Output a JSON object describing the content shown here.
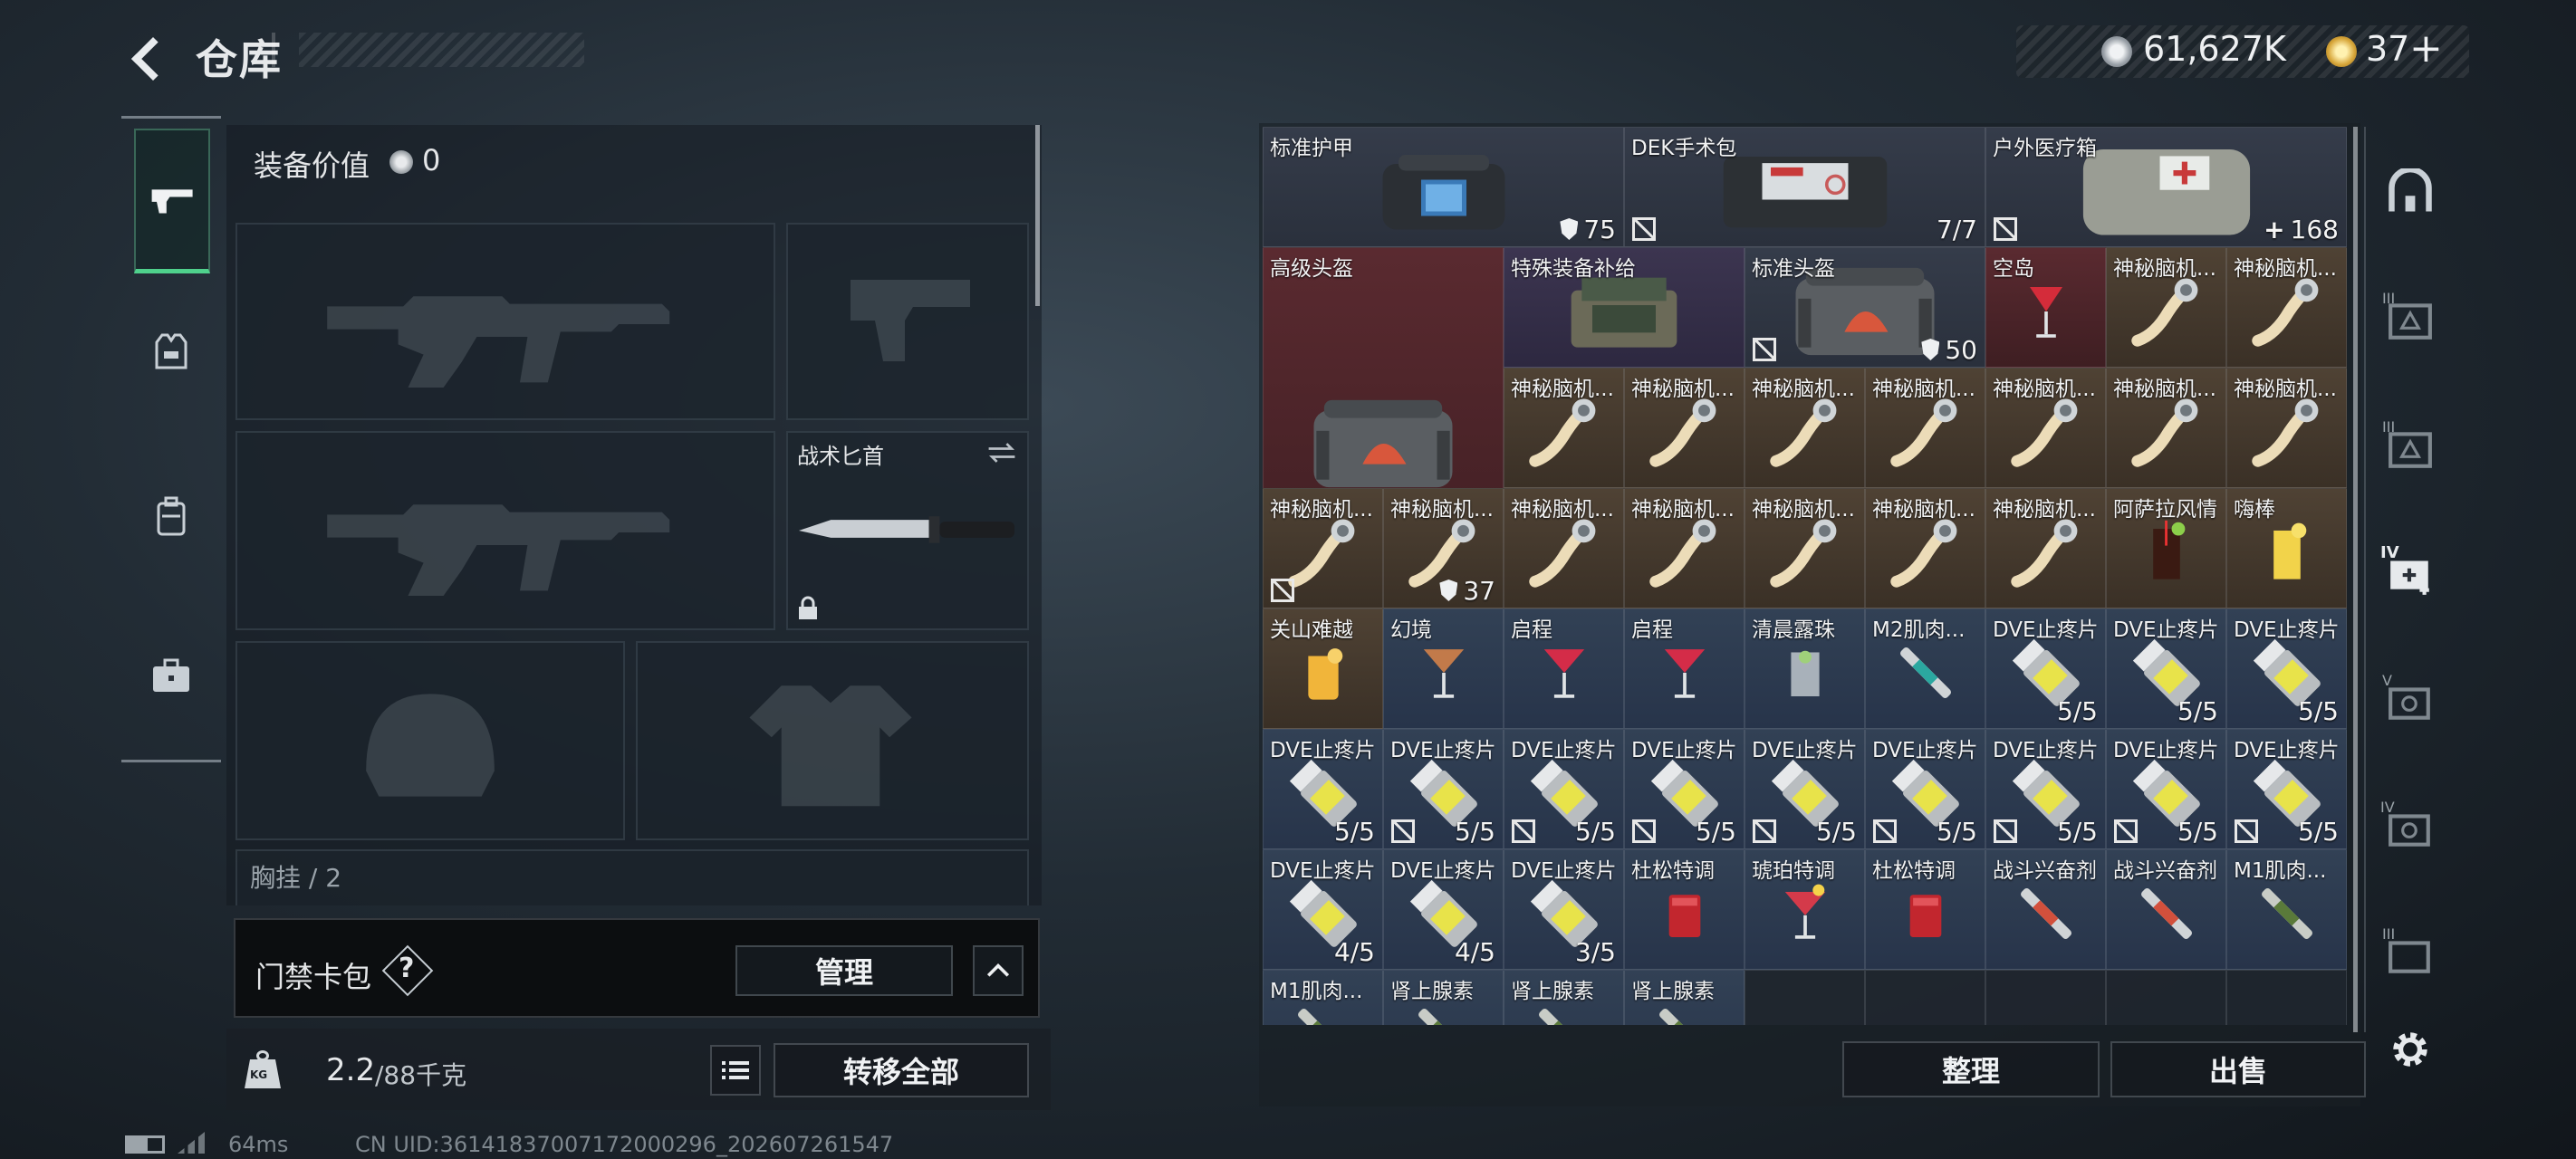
{
  "header": {
    "title": "仓库",
    "coins": "61,627K",
    "tickets": "37",
    "tickets_plus": "+"
  },
  "left": {
    "equip_value_label": "装备价值",
    "equip_value": "0",
    "knife_label": "战术匕首",
    "chest_label": "胸挂 / 2",
    "keycard_label": "门禁卡包",
    "keycard_help": "?",
    "manage_label": "管理",
    "weight_value": "2.2",
    "weight_unit": "/88千克",
    "kg_icon_text": "KG",
    "transfer_all_label": "转移全部"
  },
  "footer": {
    "ping": "64ms",
    "uid": "CN UID:36141837007172000296_202607261547"
  },
  "actions": {
    "sort_label": "整理",
    "sell_label": "出售"
  },
  "side_labels": {
    "t3": "III",
    "t2": "III",
    "t4": "IV",
    "t5": "V",
    "t4b": "IV",
    "t3b": "III"
  },
  "items": [
    {
      "name": "标准护甲",
      "icon": "armor-bag",
      "rarity": "gray",
      "badge": "75",
      "c": 1,
      "r": 1,
      "w": 3,
      "h": 1,
      "shield": true
    },
    {
      "name": "DEK手术包",
      "icon": "surgery-kit",
      "rarity": "gray",
      "badge": "7/7",
      "c": 4,
      "r": 1,
      "w": 3,
      "h": 1,
      "nt": true
    },
    {
      "name": "户外医疗箱",
      "icon": "medical-box",
      "rarity": "gray",
      "badge": "168",
      "c": 7,
      "r": 1,
      "w": 3,
      "h": 1,
      "nt": true,
      "plus": true
    },
    {
      "name": "高级头盔",
      "icon": "helmet-bag",
      "rarity": "red",
      "badge": "37",
      "c": 1,
      "r": 2,
      "w": 2,
      "h": 3,
      "nt": true,
      "shield": true
    },
    {
      "name": "特殊装备补给",
      "icon": "supply-crate",
      "rarity": "purple",
      "c": 3,
      "r": 2,
      "w": 2,
      "h": 1
    },
    {
      "name": "标准头盔",
      "icon": "helmet-bag",
      "rarity": "gray",
      "badge": "50",
      "c": 5,
      "r": 2,
      "w": 2,
      "h": 1,
      "nt": true,
      "shield": true
    },
    {
      "name": "空岛",
      "icon": "cocktail-red",
      "rarity": "red",
      "c": 7,
      "r": 2
    },
    {
      "name": "神秘脑机...",
      "icon": "brain-chip",
      "rarity": "gold",
      "c": 8,
      "r": 2
    },
    {
      "name": "神秘脑机...",
      "icon": "brain-chip",
      "rarity": "gold",
      "c": 9,
      "r": 2
    },
    {
      "name": "神秘脑机...",
      "icon": "brain-chip",
      "rarity": "gold",
      "c": 3,
      "r": 3
    },
    {
      "name": "神秘脑机...",
      "icon": "brain-chip",
      "rarity": "gold",
      "c": 4,
      "r": 3
    },
    {
      "name": "神秘脑机...",
      "icon": "brain-chip",
      "rarity": "gold",
      "c": 5,
      "r": 3
    },
    {
      "name": "神秘脑机...",
      "icon": "brain-chip",
      "rarity": "gold",
      "c": 6,
      "r": 3
    },
    {
      "name": "神秘脑机...",
      "icon": "brain-chip",
      "rarity": "gold",
      "c": 7,
      "r": 3
    },
    {
      "name": "神秘脑机...",
      "icon": "brain-chip",
      "rarity": "gold",
      "c": 8,
      "r": 3
    },
    {
      "name": "神秘脑机...",
      "icon": "brain-chip",
      "rarity": "gold",
      "c": 9,
      "r": 3
    },
    {
      "name": "神秘脑机...",
      "icon": "brain-chip",
      "rarity": "gold",
      "c": 1,
      "r": 4
    },
    {
      "name": "神秘脑机...",
      "icon": "brain-chip",
      "rarity": "gold",
      "c": 2,
      "r": 4
    },
    {
      "name": "神秘脑机...",
      "icon": "brain-chip",
      "rarity": "gold",
      "c": 3,
      "r": 4
    },
    {
      "name": "神秘脑机...",
      "icon": "brain-chip",
      "rarity": "gold",
      "c": 4,
      "r": 4
    },
    {
      "name": "神秘脑机...",
      "icon": "brain-chip",
      "rarity": "gold",
      "c": 5,
      "r": 4
    },
    {
      "name": "神秘脑机...",
      "icon": "brain-chip",
      "rarity": "gold",
      "c": 6,
      "r": 4
    },
    {
      "name": "神秘脑机...",
      "icon": "brain-chip",
      "rarity": "gold",
      "c": 7,
      "r": 4
    },
    {
      "name": "阿萨拉风情",
      "icon": "cocktail-cola",
      "rarity": "gold",
      "c": 8,
      "r": 4
    },
    {
      "name": "嗨棒",
      "icon": "cocktail-yellow",
      "rarity": "gold",
      "c": 9,
      "r": 4
    },
    {
      "name": "关山难越",
      "icon": "cocktail-orange",
      "rarity": "gold",
      "c": 1,
      "r": 5
    },
    {
      "name": "幻境",
      "icon": "martini-brown",
      "rarity": "blue",
      "c": 2,
      "r": 5
    },
    {
      "name": "启程",
      "icon": "martini-red",
      "rarity": "blue",
      "c": 3,
      "r": 5
    },
    {
      "name": "启程",
      "icon": "martini-red",
      "rarity": "blue",
      "c": 4,
      "r": 5
    },
    {
      "name": "清晨露珠",
      "icon": "glass-clear",
      "rarity": "blue",
      "c": 5,
      "r": 5
    },
    {
      "name": "M2肌肉...",
      "icon": "injector-teal",
      "rarity": "blue",
      "c": 6,
      "r": 5
    },
    {
      "name": "DVE止疼片",
      "icon": "pill-bottle",
      "rarity": "blue",
      "badge": "5/5",
      "c": 7,
      "r": 5
    },
    {
      "name": "DVE止疼片",
      "icon": "pill-bottle",
      "rarity": "blue",
      "badge": "5/5",
      "c": 8,
      "r": 5
    },
    {
      "name": "DVE止疼片",
      "icon": "pill-bottle",
      "rarity": "blue",
      "badge": "5/5",
      "c": 9,
      "r": 5
    },
    {
      "name": "DVE止疼片",
      "icon": "pill-bottle",
      "rarity": "blue",
      "badge": "5/5",
      "c": 1,
      "r": 6
    },
    {
      "name": "DVE止疼片",
      "icon": "pill-bottle",
      "rarity": "blue",
      "badge": "5/5",
      "c": 2,
      "r": 6,
      "nt": true
    },
    {
      "name": "DVE止疼片",
      "icon": "pill-bottle",
      "rarity": "blue",
      "badge": "5/5",
      "c": 3,
      "r": 6,
      "nt": true
    },
    {
      "name": "DVE止疼片",
      "icon": "pill-bottle",
      "rarity": "blue",
      "badge": "5/5",
      "c": 4,
      "r": 6,
      "nt": true
    },
    {
      "name": "DVE止疼片",
      "icon": "pill-bottle",
      "rarity": "blue",
      "badge": "5/5",
      "c": 5,
      "r": 6,
      "nt": true
    },
    {
      "name": "DVE止疼片",
      "icon": "pill-bottle",
      "rarity": "blue",
      "badge": "5/5",
      "c": 6,
      "r": 6,
      "nt": true
    },
    {
      "name": "DVE止疼片",
      "icon": "pill-bottle",
      "rarity": "blue",
      "badge": "5/5",
      "c": 7,
      "r": 6,
      "nt": true
    },
    {
      "name": "DVE止疼片",
      "icon": "pill-bottle",
      "rarity": "blue",
      "badge": "5/5",
      "c": 8,
      "r": 6,
      "nt": true
    },
    {
      "name": "DVE止疼片",
      "icon": "pill-bottle",
      "rarity": "blue",
      "badge": "5/5",
      "c": 9,
      "r": 6,
      "nt": true
    },
    {
      "name": "DVE止疼片",
      "icon": "pill-bottle",
      "rarity": "blue",
      "badge": "4/5",
      "c": 1,
      "r": 7
    },
    {
      "name": "DVE止疼片",
      "icon": "pill-bottle",
      "rarity": "blue",
      "badge": "4/5",
      "c": 2,
      "r": 7
    },
    {
      "name": "DVE止疼片",
      "icon": "pill-bottle",
      "rarity": "blue",
      "badge": "3/5",
      "c": 3,
      "r": 7
    },
    {
      "name": "杜松特调",
      "icon": "glass-red",
      "rarity": "blue",
      "c": 4,
      "r": 7
    },
    {
      "name": "琥珀特调",
      "icon": "martini-amber",
      "rarity": "blue",
      "c": 5,
      "r": 7
    },
    {
      "name": "杜松特调",
      "icon": "glass-red",
      "rarity": "blue",
      "c": 6,
      "r": 7
    },
    {
      "name": "战斗兴奋剂",
      "icon": "injector-red",
      "rarity": "blue",
      "c": 7,
      "r": 7
    },
    {
      "name": "战斗兴奋剂",
      "icon": "injector-red",
      "rarity": "blue",
      "c": 8,
      "r": 7
    },
    {
      "name": "M1肌肉...",
      "icon": "injector-green",
      "rarity": "blue",
      "c": 9,
      "r": 7
    },
    {
      "name": "M1肌肉...",
      "icon": "injector-green",
      "rarity": "blue",
      "c": 1,
      "r": 8
    },
    {
      "name": "肾上腺素",
      "icon": "injector-green",
      "rarity": "blue",
      "c": 2,
      "r": 8
    },
    {
      "name": "肾上腺素",
      "icon": "injector-green",
      "rarity": "blue",
      "c": 3,
      "r": 8
    },
    {
      "name": "肾上腺素",
      "icon": "injector-green",
      "rarity": "blue",
      "c": 4,
      "r": 8
    }
  ],
  "colors": {
    "gray": "#353c4a",
    "blue": "#324155",
    "purple": "#3c3550",
    "gold": "#4f4234",
    "red": "#5a2a30",
    "empty": "#232a34"
  }
}
